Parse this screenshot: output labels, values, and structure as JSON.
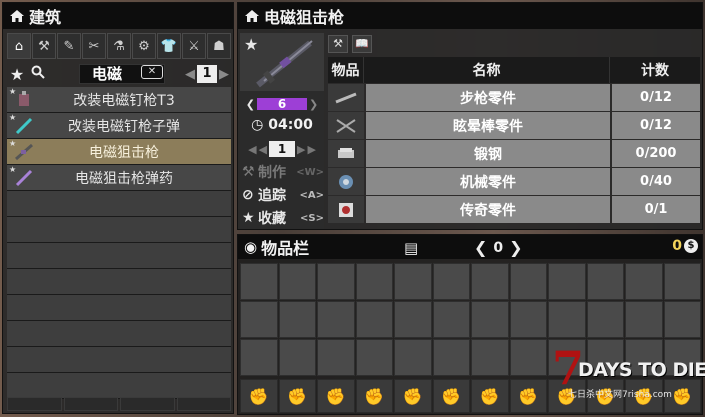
{
  "craft": {
    "title": "建筑",
    "categories": [
      "⌂",
      "⚒",
      "✎",
      "✂",
      "⚗",
      "⚙",
      "👕",
      "⚔",
      "☗"
    ],
    "search_value": "电磁",
    "page": "1",
    "recipes": [
      {
        "label": "改装电磁钉枪T3",
        "selected": false
      },
      {
        "label": "改装电磁钉枪子弹",
        "selected": false
      },
      {
        "label": "电磁狙击枪",
        "selected": true
      },
      {
        "label": "电磁狙击枪弹药",
        "selected": false
      }
    ]
  },
  "detail": {
    "title": "电磁狙击枪",
    "tier": "6",
    "time": "04:00",
    "count": "1",
    "actions": {
      "make": "制作",
      "make_key": "<W>",
      "track": "追踪",
      "track_key": "<A>",
      "fav": "收藏",
      "fav_key": "<S>"
    },
    "headers": {
      "item": "物品",
      "name": "名称",
      "count": "计数"
    },
    "ingredients": [
      {
        "name": "步枪零件",
        "count": "0/12"
      },
      {
        "name": "眩晕棒零件",
        "count": "0/12"
      },
      {
        "name": "锻钢",
        "count": "0/200"
      },
      {
        "name": "机械零件",
        "count": "0/40"
      },
      {
        "name": "传奇零件",
        "count": "0/1"
      }
    ]
  },
  "inventory": {
    "title": "物品栏",
    "page": "0",
    "money": "0",
    "coin_symbol": "$"
  },
  "watermark": {
    "number": "7",
    "game": "DAYS TO DIE",
    "site": "七日杀中文网7risha.com"
  },
  "colors": {
    "tier": "#9d3fd6",
    "selected_row": "#8c7d5a",
    "money": "#f3d35a"
  }
}
